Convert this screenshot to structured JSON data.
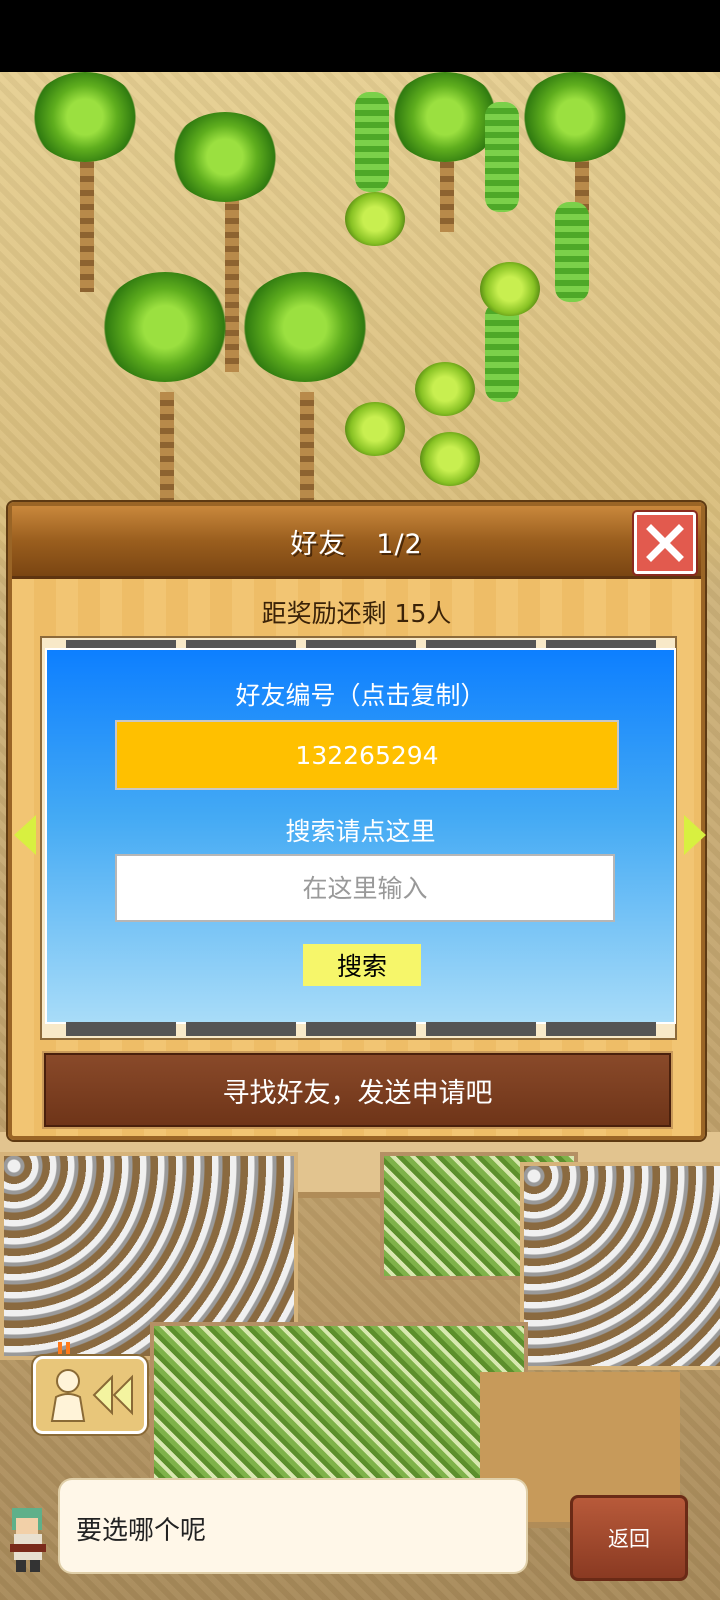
{
  "dialog": {
    "title": "好友",
    "page": "1/2",
    "reward_text": "距奖励还剩 15人",
    "friend_id_label": "好友编号（点击复制）",
    "friend_id": "132265294",
    "search_label": "搜索请点这里",
    "search_placeholder": "在这里输入",
    "search_button": "搜索",
    "find_friends_button": "寻找好友，发送申请吧"
  },
  "hud": {
    "speech_text": "要选哪个呢",
    "back_button": "返回"
  },
  "icons": {
    "close": "close-icon",
    "prev": "arrow-left-icon",
    "next": "arrow-right-icon",
    "rewind": "rewind-icon",
    "character": "character-icon"
  },
  "colors": {
    "panel_blue": "#0d7fff",
    "id_box": "#ffc000",
    "close_red": "#e25a4e",
    "search_button": "#f6f66a",
    "arrow_green": "#d8f040"
  }
}
